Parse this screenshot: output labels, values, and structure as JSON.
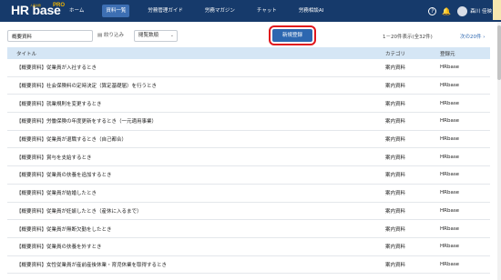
{
  "header": {
    "logo": "HR base",
    "logo_sub": "人事労務",
    "logo_pro": "PRO",
    "nav": [
      {
        "label": "ホーム"
      },
      {
        "label": "資料一覧"
      },
      {
        "label": "労務管理ガイド"
      },
      {
        "label": "労務マガジン"
      },
      {
        "label": "チャット"
      },
      {
        "label": "労務相談AI"
      }
    ],
    "active_nav": "資料一覧",
    "help_icon": "?",
    "bell_icon": "bell-icon",
    "username": "森川 佳映"
  },
  "filters": {
    "search_value": "概要資料",
    "narrow_label": "絞り込み",
    "sort_value": "閲覧数順",
    "new_button": "新規登録",
    "count_text": "1－20件表示(全32件)",
    "next_link": "次の20件"
  },
  "table": {
    "headers": {
      "title": "タイトル",
      "category": "カテゴリ",
      "registrant": "登録元"
    },
    "rows": [
      {
        "title": "【概要資料】従業員が入社するとき",
        "category": "案内資料",
        "registrant": "HRbase"
      },
      {
        "title": "【概要資料】社会保険料の定時決定（算定基礎届）を行うとき",
        "category": "案内資料",
        "registrant": "HRbase"
      },
      {
        "title": "【概要資料】就業規則を変更するとき",
        "category": "案内資料",
        "registrant": "HRbase"
      },
      {
        "title": "【概要資料】労働保険の年度更新をするとき（一元適用事業）",
        "category": "案内資料",
        "registrant": "HRbase"
      },
      {
        "title": "【概要資料】従業員が退職するとき（自己都合）",
        "category": "案内資料",
        "registrant": "HRbase"
      },
      {
        "title": "【概要資料】賞与を支給するとき",
        "category": "案内資料",
        "registrant": "HRbase"
      },
      {
        "title": "【概要資料】従業員の扶養を追加するとき",
        "category": "案内資料",
        "registrant": "HRbase"
      },
      {
        "title": "【概要資料】従業員が結婚したとき",
        "category": "案内資料",
        "registrant": "HRbase"
      },
      {
        "title": "【概要資料】従業員が妊娠したとき（産休に入るまで）",
        "category": "案内資料",
        "registrant": "HRbase"
      },
      {
        "title": "【概要資料】従業員が無断欠勤をしたとき",
        "category": "案内資料",
        "registrant": "HRbase"
      },
      {
        "title": "【概要資料】従業員の扶養を外すとき",
        "category": "案内資料",
        "registrant": "HRbase"
      },
      {
        "title": "【概要資料】女性従業員が産前産後休業・育児休業を取得するとき",
        "category": "案内資料",
        "registrant": "HRbase"
      }
    ]
  },
  "colors": {
    "header_bg": "#163a6b",
    "accent": "#2d67b0",
    "highlight": "#e0161c",
    "table_header": "#d5e6f5"
  }
}
